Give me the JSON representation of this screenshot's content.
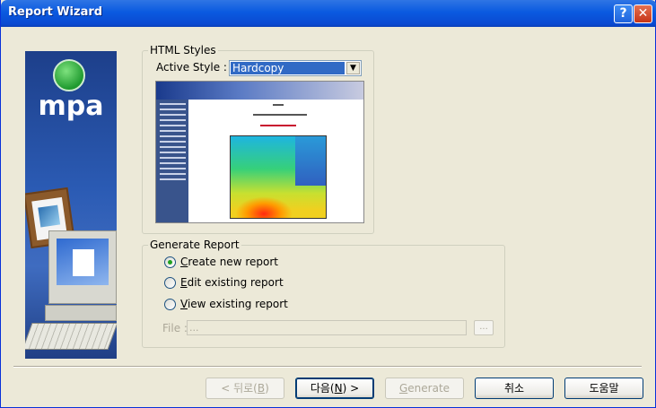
{
  "window": {
    "title": "Report Wizard",
    "help_glyph": "?",
    "close_glyph": "✕"
  },
  "banner": {
    "logo_text": "mpa"
  },
  "html_styles": {
    "legend": "HTML Styles",
    "active_style_label": "Active Style :",
    "selected_style": "Hardcopy",
    "dropdown_glyph": "▼"
  },
  "generate_report": {
    "legend": "Generate Report",
    "options": [
      {
        "prefix": "",
        "accel": "C",
        "rest": "reate new report",
        "checked": true
      },
      {
        "prefix": "",
        "accel": "E",
        "rest": "dit existing report",
        "checked": false
      },
      {
        "prefix": "",
        "accel": "V",
        "rest": "iew existing report",
        "checked": false
      }
    ],
    "file_label": "File :",
    "file_value": "...",
    "browse_label": "..."
  },
  "buttons": {
    "back": {
      "pre": "< 뒤로(",
      "accel": "B",
      "post": ")"
    },
    "next": {
      "pre": "다음(",
      "accel": "N",
      "post": ") >"
    },
    "generate": {
      "pre": "",
      "accel": "G",
      "post": "enerate"
    },
    "cancel": "취소",
    "help": "도움말"
  },
  "colors": {
    "title_bar": "#0a5ae0",
    "selection": "#316ac5",
    "dialog_bg": "#ece9d8"
  },
  "icons": [
    "help-icon",
    "close-icon",
    "power-icon",
    "dropdown-arrow-icon",
    "radio-icon"
  ]
}
